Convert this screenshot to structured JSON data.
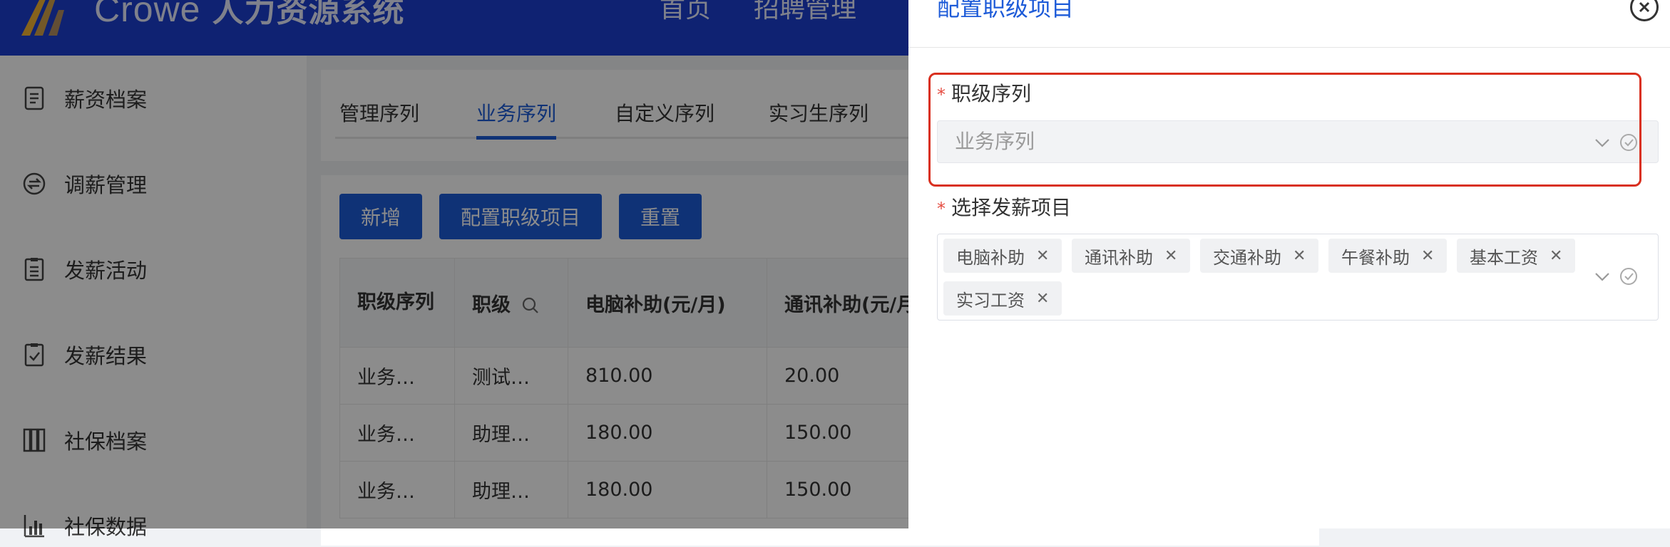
{
  "header": {
    "brand_latin": "Crowe",
    "brand_cjk": "人力资源系统",
    "nav": [
      "首页",
      "招聘管理"
    ]
  },
  "sidebar": {
    "items": [
      {
        "label": "薪资档案",
        "icon": "document-icon"
      },
      {
        "label": "调薪管理",
        "icon": "exchange-circle-icon"
      },
      {
        "label": "发薪活动",
        "icon": "clipboard-list-icon"
      },
      {
        "label": "发薪结果",
        "icon": "clipboard-check-icon"
      },
      {
        "label": "社保档案",
        "icon": "columns-icon"
      },
      {
        "label": "社保数据",
        "icon": "bar-chart-icon"
      }
    ]
  },
  "tabs": [
    "管理序列",
    "业务序列",
    "自定义序列",
    "实习生序列"
  ],
  "active_tab": "业务序列",
  "toolbar": {
    "add": "新增",
    "config": "配置职级项目",
    "reset": "重置"
  },
  "table": {
    "headers": [
      "职级序列",
      "职级",
      "电脑补助(元/月)",
      "通讯补助(元/月"
    ],
    "rows": [
      [
        "业务…",
        "测试…",
        "810.00",
        "20.00"
      ],
      [
        "业务…",
        "助理…",
        "180.00",
        "150.00"
      ],
      [
        "业务…",
        "助理…",
        "180.00",
        "150.00"
      ]
    ]
  },
  "drawer": {
    "title": "配置职级项目",
    "field1": {
      "label": "职级序列",
      "required_mark": "*",
      "value": "业务序列"
    },
    "field2": {
      "label": "选择发薪项目",
      "required_mark": "*",
      "tags": [
        "电脑补助",
        "通讯补助",
        "交通补助",
        "午餐补助",
        "基本工资",
        "实习工资"
      ]
    }
  },
  "colors": {
    "primary": "#1d5bd8",
    "header": "#1d3fcf",
    "highlight": "#d9301f",
    "required": "#e54d42"
  }
}
